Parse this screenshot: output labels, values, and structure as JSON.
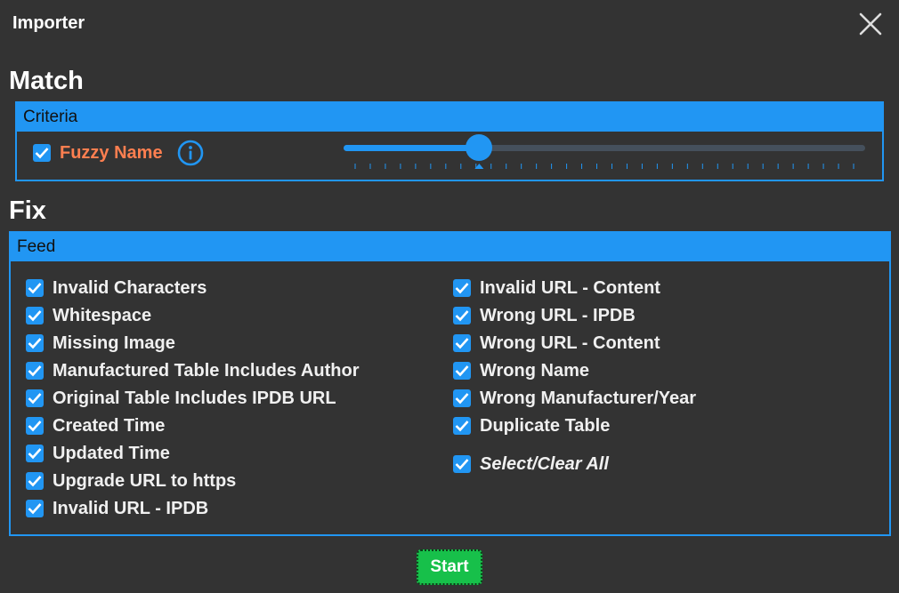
{
  "window": {
    "title": "Importer"
  },
  "match": {
    "heading": "Match",
    "criteria_title": "Criteria",
    "fuzzy": {
      "label": "Fuzzy Name",
      "checked": true,
      "slider_fraction": 0.26,
      "tick_count": 34
    }
  },
  "fix": {
    "heading": "Fix",
    "feed_title": "Feed",
    "left_items": [
      "Invalid Characters",
      "Whitespace",
      "Missing Image",
      "Manufactured Table Includes Author",
      "Original Table Includes IPDB URL",
      "Created Time",
      "Updated Time",
      "Upgrade URL to https",
      "Invalid URL - IPDB"
    ],
    "right_items": [
      "Invalid URL - Content",
      "Wrong URL - IPDB",
      "Wrong URL - Content",
      "Wrong Name",
      "Wrong Manufacturer/Year",
      "Duplicate Table"
    ],
    "select_all": "Select/Clear All"
  },
  "actions": {
    "start": "Start"
  },
  "colors": {
    "accent": "#2196f3",
    "background": "#333333",
    "fuzzy_label": "#ff7f50",
    "start_button": "#17c04a"
  },
  "icons": {
    "close": "close-icon",
    "info": "info-icon",
    "check": "checkmark-icon"
  }
}
